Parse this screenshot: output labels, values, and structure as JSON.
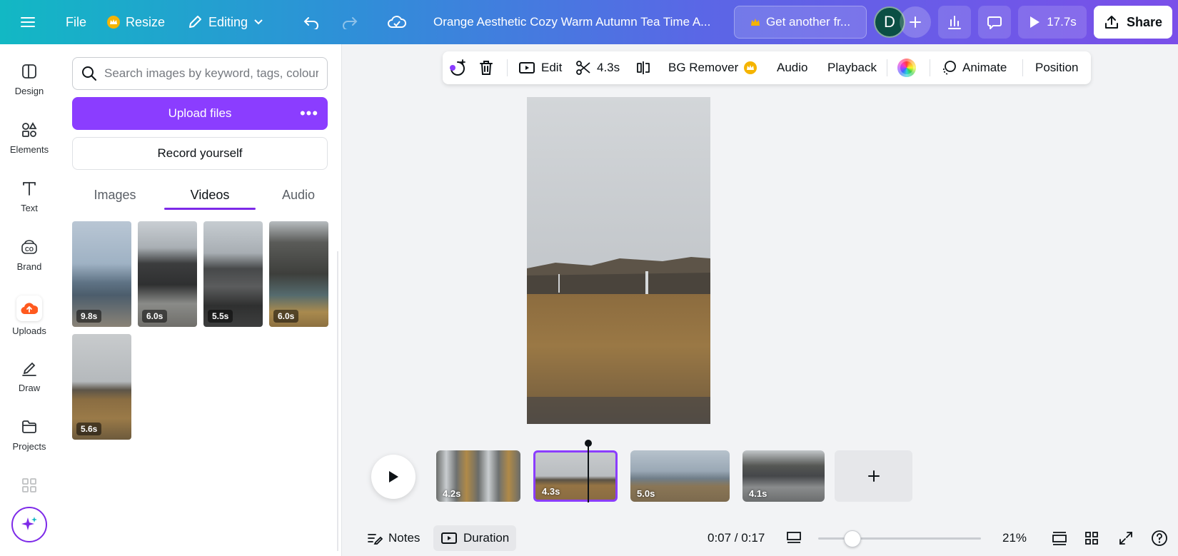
{
  "topbar": {
    "file_label": "File",
    "resize_label": "Resize",
    "editing_label": "Editing",
    "title": "Orange Aesthetic Cozy Warm Autumn Tea Time A...",
    "upgrade_label": "Get another fr...",
    "avatar_initial": "D",
    "present_duration": "17.7s",
    "share_label": "Share"
  },
  "rail": {
    "items": [
      {
        "label": "Design",
        "icon": "design-icon"
      },
      {
        "label": "Elements",
        "icon": "elements-icon"
      },
      {
        "label": "Text",
        "icon": "text-icon"
      },
      {
        "label": "Brand",
        "icon": "brand-icon"
      },
      {
        "label": "Uploads",
        "icon": "uploads-icon"
      },
      {
        "label": "Draw",
        "icon": "draw-icon"
      },
      {
        "label": "Projects",
        "icon": "projects-icon"
      }
    ]
  },
  "panel": {
    "search_placeholder": "Search images by keyword, tags, colour...",
    "upload_label": "Upload files",
    "record_label": "Record yourself",
    "tabs": [
      "Images",
      "Videos",
      "Audio"
    ],
    "active_tab": "Videos",
    "videos": [
      {
        "duration": "9.8s"
      },
      {
        "duration": "6.0s"
      },
      {
        "duration": "5.5s"
      },
      {
        "duration": "6.0s"
      },
      {
        "duration": "5.6s"
      }
    ]
  },
  "context_toolbar": {
    "edit_label": "Edit",
    "trim_duration": "4.3s",
    "bg_remover_label": "BG Remover",
    "audio_label": "Audio",
    "playback_label": "Playback",
    "animate_label": "Animate",
    "position_label": "Position"
  },
  "timeline": {
    "clips": [
      {
        "duration": "4.2s"
      },
      {
        "duration": "4.3s",
        "selected": true
      },
      {
        "duration": "5.0s"
      },
      {
        "duration": "4.1s"
      }
    ]
  },
  "bottombar": {
    "notes_label": "Notes",
    "duration_label": "Duration",
    "time_readout": "0:07 / 0:17",
    "zoom_level": "21%"
  },
  "colors": {
    "accent": "#8b3dff",
    "topbar_start": "#12b8c4",
    "topbar_end": "#7a4fe9",
    "avatar": "#0b4f44"
  }
}
